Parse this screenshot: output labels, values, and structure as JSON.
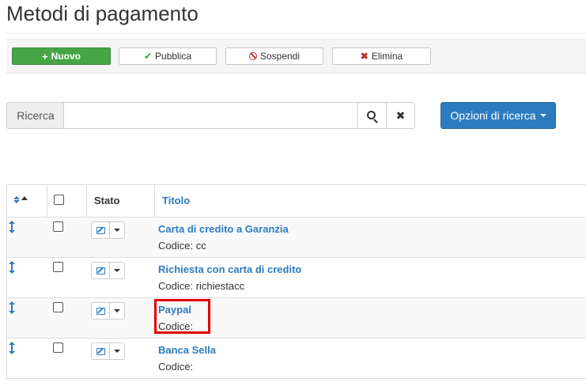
{
  "page": {
    "title": "Metodi di pagamento"
  },
  "toolbar": {
    "new_label": "Nuovo",
    "publish_label": "Pubblica",
    "suspend_label": "Sospendi",
    "delete_label": "Elimina"
  },
  "search": {
    "label": "Ricerca",
    "value": "",
    "placeholder": "",
    "options_label": "Opzioni di ricerca"
  },
  "table": {
    "headers": {
      "state": "Stato",
      "title": "Titolo"
    },
    "rows": [
      {
        "title": "Carta di credito a Garanzia",
        "code": "Codice: cc"
      },
      {
        "title": "Richiesta con carta di credito",
        "code": "Codice: richiestacc"
      },
      {
        "title": "Paypal",
        "code": "Codice:"
      },
      {
        "title": "Banca Sella",
        "code": "Codice:"
      }
    ]
  },
  "colors": {
    "primary": "#2d7bbf",
    "success": "#46a546",
    "danger": "#c9302c",
    "highlight": "#e00000"
  },
  "icons": [
    "plus-icon",
    "check-icon",
    "ban-icon",
    "times-icon",
    "search-icon",
    "clear-icon",
    "sort-icon",
    "drag-handle-icon",
    "edit-icon",
    "caret-down-icon"
  ]
}
